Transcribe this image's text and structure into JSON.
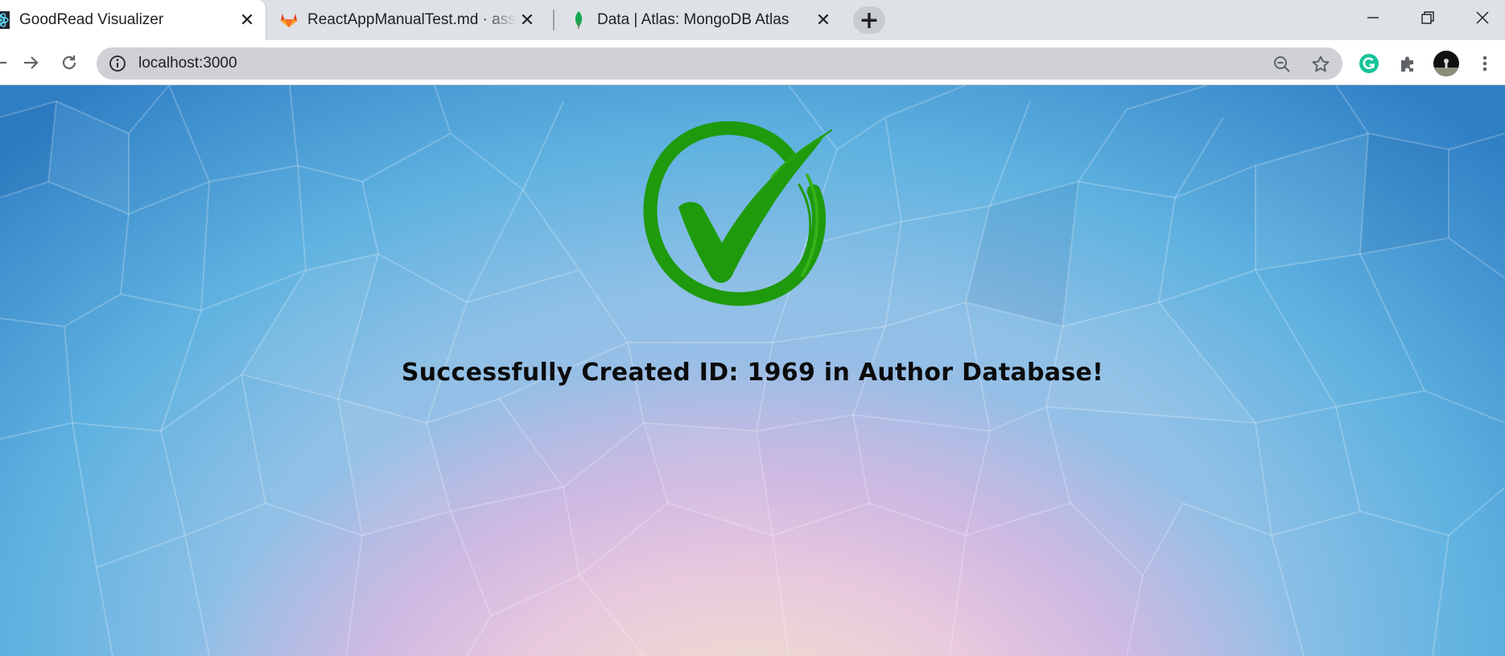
{
  "browser": {
    "tabs": [
      {
        "title": "GoodRead Visualizer",
        "icon": "react-icon",
        "active": true
      },
      {
        "title": "ReactAppManualTest.md · assignment",
        "icon": "gitlab-icon",
        "active": false
      },
      {
        "title": "Data | Atlas: MongoDB Atlas",
        "icon": "mongodb-leaf-icon",
        "active": false
      }
    ],
    "close_glyph": "✕",
    "newtab_glyph": "+",
    "window_controls": {
      "minimize": "—",
      "restore": "❐",
      "close": "✕"
    },
    "address": "localhost:3000"
  },
  "page": {
    "message": "Successfully Created ID: 1969 in Author Database!",
    "check_color": "#1f9a0c"
  },
  "colors": {
    "tabstrip": "#dee1e6",
    "toolbar": "#ffffff",
    "omnibox": "#cfd1d5",
    "grammarly": "#15c39a"
  }
}
